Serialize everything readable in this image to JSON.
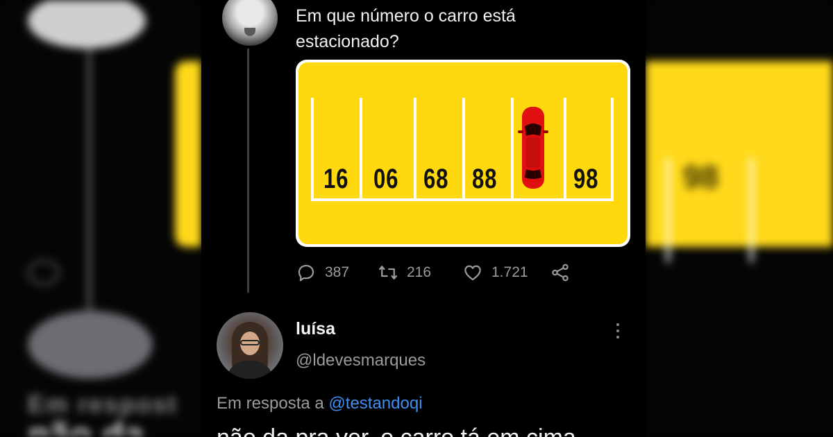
{
  "tweet": {
    "text": "Em que número o carro está estacionado?",
    "puzzle_numbers": [
      "16",
      "06",
      "68",
      "88",
      "98"
    ],
    "colors": {
      "puzzle_bg": "#ffd80d",
      "car": "#e01010"
    }
  },
  "actions": {
    "replies": "387",
    "retweets": "216",
    "likes": "1.721"
  },
  "reply": {
    "name": "luísa",
    "handle": "@ldevesmarques",
    "replying_prefix": "Em resposta a",
    "replying_mention": "@testandoqi",
    "body": "não da pra ver, o carro tá em cima"
  },
  "background": {
    "left_text": "Em respost",
    "left_body": "não da",
    "right_number": "98"
  },
  "icons": [
    "reply-icon",
    "retweet-icon",
    "like-icon",
    "share-icon",
    "more-icon"
  ]
}
